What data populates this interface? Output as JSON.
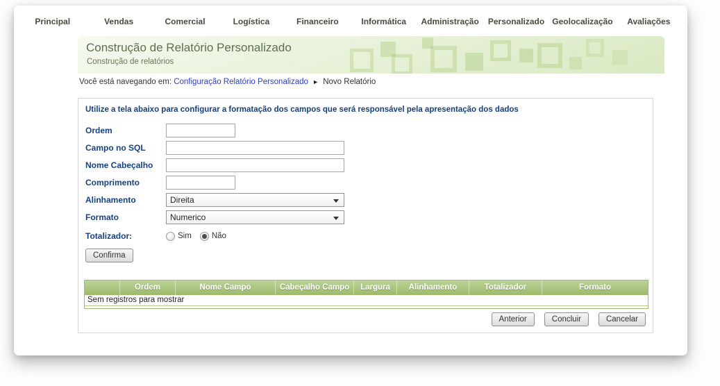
{
  "nav": {
    "items": [
      {
        "label": "Principal"
      },
      {
        "label": "Vendas"
      },
      {
        "label": "Comercial"
      },
      {
        "label": "Logística"
      },
      {
        "label": "Financeiro"
      },
      {
        "label": "Informática"
      },
      {
        "label": "Administração"
      },
      {
        "label": "Personalizado"
      },
      {
        "label": "Geolocalização"
      },
      {
        "label": "Avaliações"
      }
    ]
  },
  "banner": {
    "title": "Construção de Relatório Personalizado",
    "subtitle": "Construção de relatórios"
  },
  "breadcrumb": {
    "prefix": "Você está navegando em:",
    "link": "Configuração Relatório Personalizado",
    "separator": "►",
    "current": "Novo Relatório"
  },
  "form": {
    "instructions": "Utilize a tela abaixo para configurar a formatação dos campos que será responsável pela apresentação dos dados",
    "fields": {
      "ordem": {
        "label": "Ordem",
        "value": ""
      },
      "campo_sql": {
        "label": "Campo no SQL",
        "value": ""
      },
      "nome_cabecalho": {
        "label": "Nome Cabeçalho",
        "value": ""
      },
      "comprimento": {
        "label": "Comprimento",
        "value": ""
      },
      "alinhamento": {
        "label": "Alinhamento",
        "selected": "Direita"
      },
      "formato": {
        "label": "Formato",
        "selected": "Numerico"
      },
      "totalizador": {
        "label": "Totalizador:",
        "options": [
          {
            "label": "Sim",
            "checked": false
          },
          {
            "label": "Não",
            "checked": true
          }
        ]
      }
    },
    "confirm_label": "Confirma"
  },
  "table": {
    "headers": [
      "",
      "Ordem",
      "Nome Campo",
      "Cabeçalho Campo",
      "Largura",
      "Alinhamento",
      "Totalizador",
      "Formato"
    ],
    "empty_message": "Sem registros para mostrar"
  },
  "actions": {
    "previous": "Anterior",
    "finish": "Concluir",
    "cancel": "Cancelar"
  },
  "colors": {
    "table_header_green": "#9cba6a",
    "banner_green": "#dcebc8",
    "nav_underline": "#cde0ab",
    "label_navy": "#17407e",
    "link_blue": "#2b3fbe"
  }
}
